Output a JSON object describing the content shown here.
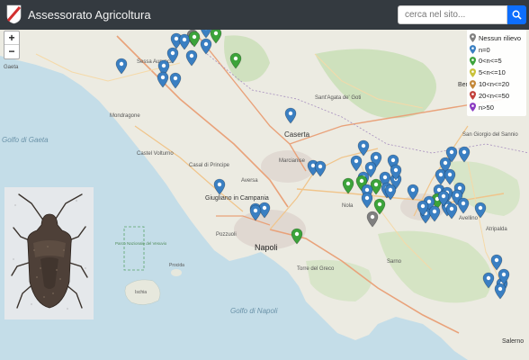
{
  "header": {
    "title": "Assessorato Agricoltura",
    "search_placeholder": "cerca nel sito...",
    "search_icon": "search-icon",
    "logo_icon": "regione-campania-logo"
  },
  "map": {
    "zoom_in_label": "+",
    "zoom_out_label": "−",
    "place_labels": [
      {
        "name": "sessa",
        "text": "Sessa Aurunca"
      },
      {
        "name": "gaeta",
        "text": "Gaeta"
      },
      {
        "name": "mondragone",
        "text": "Mondragone"
      },
      {
        "name": "castel-volturno",
        "text": "Castel Volturno"
      },
      {
        "name": "caserta",
        "text": "Caserta"
      },
      {
        "name": "benevento",
        "text": "Benevento"
      },
      {
        "name": "casal-di-principe",
        "text": "Casal di Principe"
      },
      {
        "name": "giugliano",
        "text": "Giugliano in Campania"
      },
      {
        "name": "napoli",
        "text": "Napoli"
      },
      {
        "name": "golfo-gaeta",
        "text": "Golfo di Gaeta"
      },
      {
        "name": "golfo-napoli",
        "text": "Golfo di Napoli"
      },
      {
        "name": "salerno",
        "text": "Salerno"
      },
      {
        "name": "sant-agata",
        "text": "Sant'Agata de' Goti"
      },
      {
        "name": "san-giorgio",
        "text": "San Giorgio del Sannio"
      },
      {
        "name": "avellino",
        "text": "Avellino"
      },
      {
        "name": "atripalda",
        "text": "Atripalda"
      },
      {
        "name": "procida",
        "text": "Procida"
      },
      {
        "name": "ischia",
        "text": "Ischia"
      },
      {
        "name": "nola",
        "text": "Nola"
      },
      {
        "name": "sarno",
        "text": "Sarno"
      },
      {
        "name": "marcianise",
        "text": "Marcianise"
      },
      {
        "name": "aversa",
        "text": "Aversa"
      },
      {
        "name": "pozzuoli",
        "text": "Pozzuoli"
      },
      {
        "name": "torre-greco",
        "text": "Torre del Greco"
      },
      {
        "name": "parco-vesuvio",
        "text": "Parco Nazionale del Vesuvio"
      }
    ]
  },
  "legend": {
    "items": [
      {
        "label": "Nessun rilievo",
        "color": "#7f7f7f"
      },
      {
        "label": "n=0",
        "color": "#3a7fc2"
      },
      {
        "label": "0<n<=5",
        "color": "#3ca33a"
      },
      {
        "label": "5<n<=10",
        "color": "#c9c23a"
      },
      {
        "label": "10<n<=20",
        "color": "#c4883a"
      },
      {
        "label": "20<n<=50",
        "color": "#c2403a"
      },
      {
        "label": "n>50",
        "color": "#8a3ac2"
      }
    ]
  },
  "markers": {
    "blue_count": 60,
    "green_count": 12,
    "gray_count": 2
  },
  "image": {
    "subject": "stink-bug-photo"
  }
}
